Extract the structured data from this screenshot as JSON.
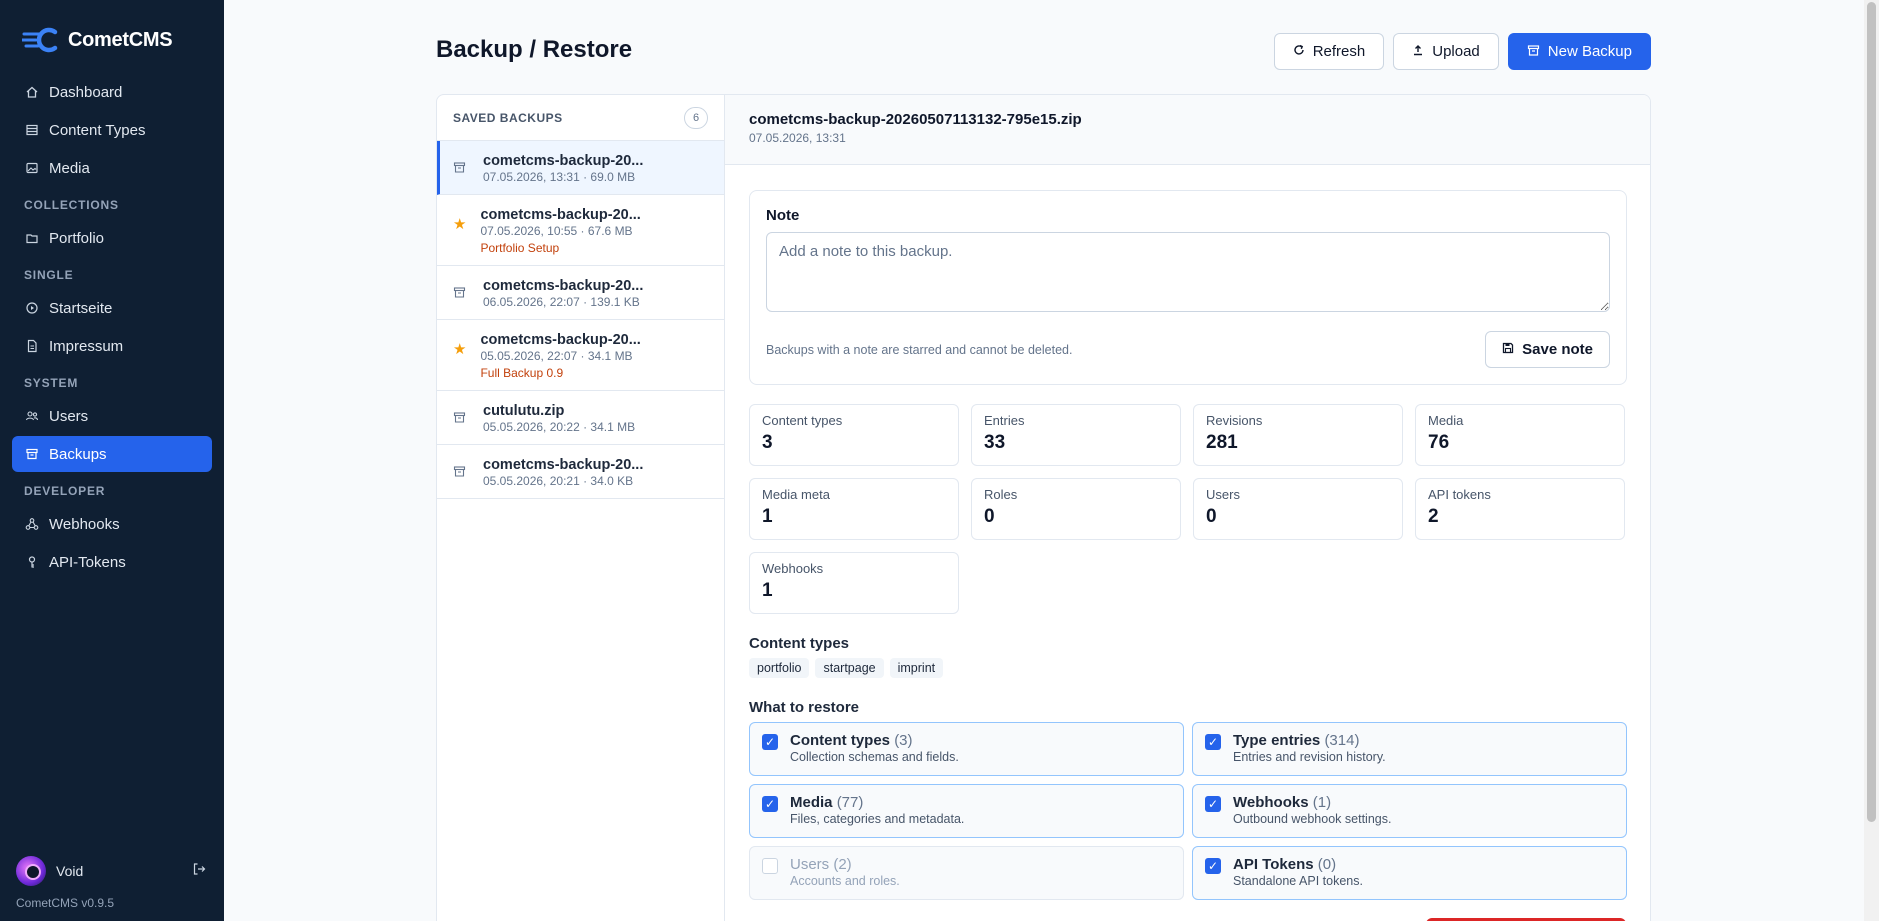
{
  "app": {
    "name": "CometCMS",
    "version": "CometCMS v0.9.5"
  },
  "sidebar": {
    "top_items": [
      {
        "label": "Dashboard",
        "icon": "home-icon"
      },
      {
        "label": "Content Types",
        "icon": "table-icon"
      },
      {
        "label": "Media",
        "icon": "image-icon"
      }
    ],
    "sections": {
      "collections": "COLLECTIONS",
      "single": "SINGLE",
      "system": "SYSTEM",
      "developer": "DEVELOPER"
    },
    "collections_items": [
      {
        "label": "Portfolio",
        "icon": "folder-icon"
      }
    ],
    "single_items": [
      {
        "label": "Startseite",
        "icon": "circle-play-icon"
      },
      {
        "label": "Impressum",
        "icon": "file-icon"
      }
    ],
    "system_items": [
      {
        "label": "Users",
        "icon": "users-icon"
      },
      {
        "label": "Backups",
        "icon": "archive-icon",
        "active": true
      }
    ],
    "developer_items": [
      {
        "label": "Webhooks",
        "icon": "webhook-icon"
      },
      {
        "label": "API-Tokens",
        "icon": "key-icon"
      }
    ],
    "user": {
      "name": "Void"
    }
  },
  "header": {
    "title": "Backup / Restore",
    "refresh_label": "Refresh",
    "upload_label": "Upload",
    "new_backup_label": "New Backup"
  },
  "backups": {
    "heading": "SAVED BACKUPS",
    "count": "6",
    "items": [
      {
        "name": "cometcms-backup-20...",
        "meta": "07.05.2026, 13:31 · 69.0 MB",
        "note": "",
        "starred": false,
        "active": true
      },
      {
        "name": "cometcms-backup-20...",
        "meta": "07.05.2026, 10:55 · 67.6 MB",
        "note": "Portfolio Setup",
        "starred": true,
        "active": false
      },
      {
        "name": "cometcms-backup-20...",
        "meta": "06.05.2026, 22:07 · 139.1 KB",
        "note": "",
        "starred": false,
        "active": false
      },
      {
        "name": "cometcms-backup-20...",
        "meta": "05.05.2026, 22:07 · 34.1 MB",
        "note": "Full Backup 0.9",
        "starred": true,
        "active": false
      },
      {
        "name": "cutulutu.zip",
        "meta": "05.05.2026, 20:22 · 34.1 MB",
        "note": "",
        "starred": false,
        "active": false
      },
      {
        "name": "cometcms-backup-20...",
        "meta": "05.05.2026, 20:21 · 34.0 KB",
        "note": "",
        "starred": false,
        "active": false
      }
    ]
  },
  "detail": {
    "filename": "cometcms-backup-20260507113132-795e15.zip",
    "date": "07.05.2026, 13:31",
    "note_label": "Note",
    "note_placeholder": "Add a note to this backup.",
    "note_hint": "Backups with a note are starred and cannot be deleted.",
    "save_note_label": "Save note",
    "stats": [
      {
        "label": "Content types",
        "value": "3"
      },
      {
        "label": "Entries",
        "value": "33"
      },
      {
        "label": "Revisions",
        "value": "281"
      },
      {
        "label": "Media",
        "value": "76"
      },
      {
        "label": "Media meta",
        "value": "1"
      },
      {
        "label": "Roles",
        "value": "0"
      },
      {
        "label": "Users",
        "value": "0"
      },
      {
        "label": "API tokens",
        "value": "2"
      },
      {
        "label": "Webhooks",
        "value": "1"
      }
    ],
    "content_types_title": "Content types",
    "content_types": [
      "portfolio",
      "startpage",
      "imprint"
    ],
    "restore_title": "What to restore",
    "restore_options": [
      {
        "title": "Content types",
        "count": "(3)",
        "desc": "Collection schemas and fields.",
        "checked": true,
        "disabled": false
      },
      {
        "title": "Type entries",
        "count": "(314)",
        "desc": "Entries and revision history.",
        "checked": true,
        "disabled": false
      },
      {
        "title": "Media",
        "count": "(77)",
        "desc": "Files, categories and metadata.",
        "checked": true,
        "disabled": false
      },
      {
        "title": "Webhooks",
        "count": "(1)",
        "desc": "Outbound webhook settings.",
        "checked": true,
        "disabled": false
      },
      {
        "title": "Users",
        "count": "(2)",
        "desc": "Accounts and roles.",
        "checked": false,
        "disabled": true
      },
      {
        "title": "API Tokens",
        "count": "(0)",
        "desc": "Standalone API tokens.",
        "checked": true,
        "disabled": false
      }
    ]
  },
  "colors": {
    "sidebar_bg": "#0f1f33",
    "accent": "#2563eb",
    "star": "#f59e0b",
    "note_text": "#c2410c",
    "danger": "#dc2626"
  }
}
